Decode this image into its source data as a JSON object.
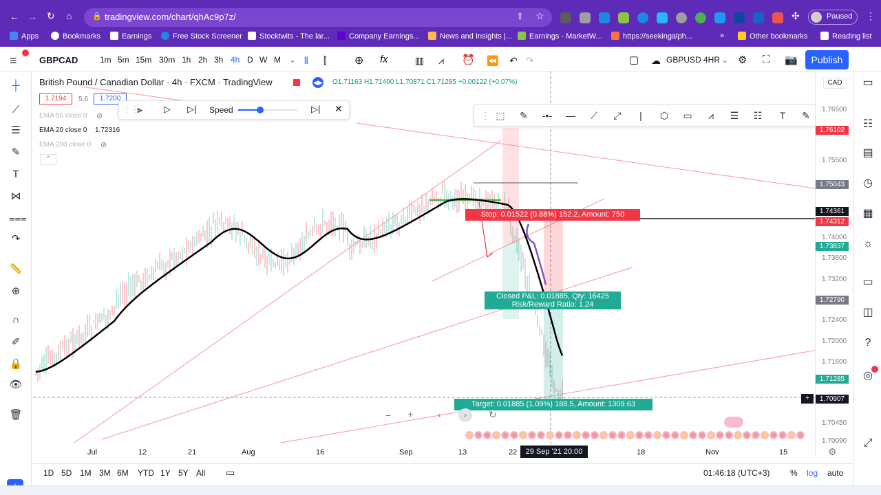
{
  "browser": {
    "url": "tradingview.com/chart/qhAc9p7z/",
    "profile_status": "Paused",
    "bookmarks": [
      "Apps",
      "Bookmarks",
      "Earnings",
      "Free Stock Screener",
      "Stocktwits - The lar...",
      "Company Earnings...",
      "News and Insights |...",
      "Earnings - MarketW...",
      "https://seekingalph...",
      "Other bookmarks",
      "Reading list"
    ]
  },
  "toolbar": {
    "symbol": "GBPCAD",
    "timeframes": [
      "1m",
      "5m",
      "15m",
      "30m",
      "1h",
      "2h",
      "3h",
      "4h",
      "D",
      "W",
      "M"
    ],
    "active_timeframe": "4h",
    "layout_name": "GBPUSD 4HR",
    "publish_label": "Publish"
  },
  "legend": {
    "title": "British Pound / Canadian Dollar · 4h · FXCM · TradingView",
    "ohlc": "O1.71163 H1.71400 L1.70871 C1.71285 +0.00122 (+0.07%)",
    "bid": "1.7194",
    "spread": "5.6",
    "ask": "1.7200",
    "ema50": "EMA 50 close 0",
    "ema20": "EMA 20 close 0",
    "ema20_value": "1.72316",
    "ema200": "EMA 200 close 0"
  },
  "replay": {
    "speed_label": "Speed"
  },
  "trade_labels": {
    "stop": "Stop: 0.01522 (0.88%) 152.2, Amount: 750",
    "closed_pnl": "Closed P&L: 0.01885, Qty: 16425",
    "risk_reward": "Risk/Reward Ratio: 1.24",
    "target": "Target: 0.01885 (1.09%) 188.5, Amount: 1309.63"
  },
  "currency": "CAD",
  "price_ticks": [
    "1.76500",
    "1.75500",
    "1.74000",
    "1.73600",
    "1.73200",
    "1.72400",
    "1.72000",
    "1.71600",
    "1.70450",
    "1.70090"
  ],
  "price_tags": [
    {
      "value": "1.76102",
      "color": "#f23645"
    },
    {
      "value": "1.75043",
      "color": "#787b86"
    },
    {
      "value": "1.74361",
      "color": "#131722"
    },
    {
      "value": "1.74312",
      "color": "#f23645"
    },
    {
      "value": "1.73837",
      "color": "#22ab94"
    },
    {
      "value": "1.72790",
      "color": "#787b86"
    },
    {
      "value": "1.71285",
      "color": "#22ab94"
    },
    {
      "value": "1.70907",
      "color": "#131722"
    }
  ],
  "time_ticks": [
    "Jul",
    "12",
    "21",
    "Aug",
    "16",
    "Sep",
    "13",
    "22",
    "18",
    "Nov",
    "15"
  ],
  "crosshair_date": "29 Sep '21  20:00",
  "ranges": [
    "1D",
    "5D",
    "1M",
    "3M",
    "6M",
    "YTD",
    "1Y",
    "5Y",
    "All"
  ],
  "clock": "01:46:18 (UTC+3)",
  "scale_options": [
    "%",
    "log",
    "auto"
  ],
  "colors": {
    "accent": "#2962ff",
    "up": "#22ab94",
    "down": "#f23645",
    "browser": "#5e2bb8"
  }
}
